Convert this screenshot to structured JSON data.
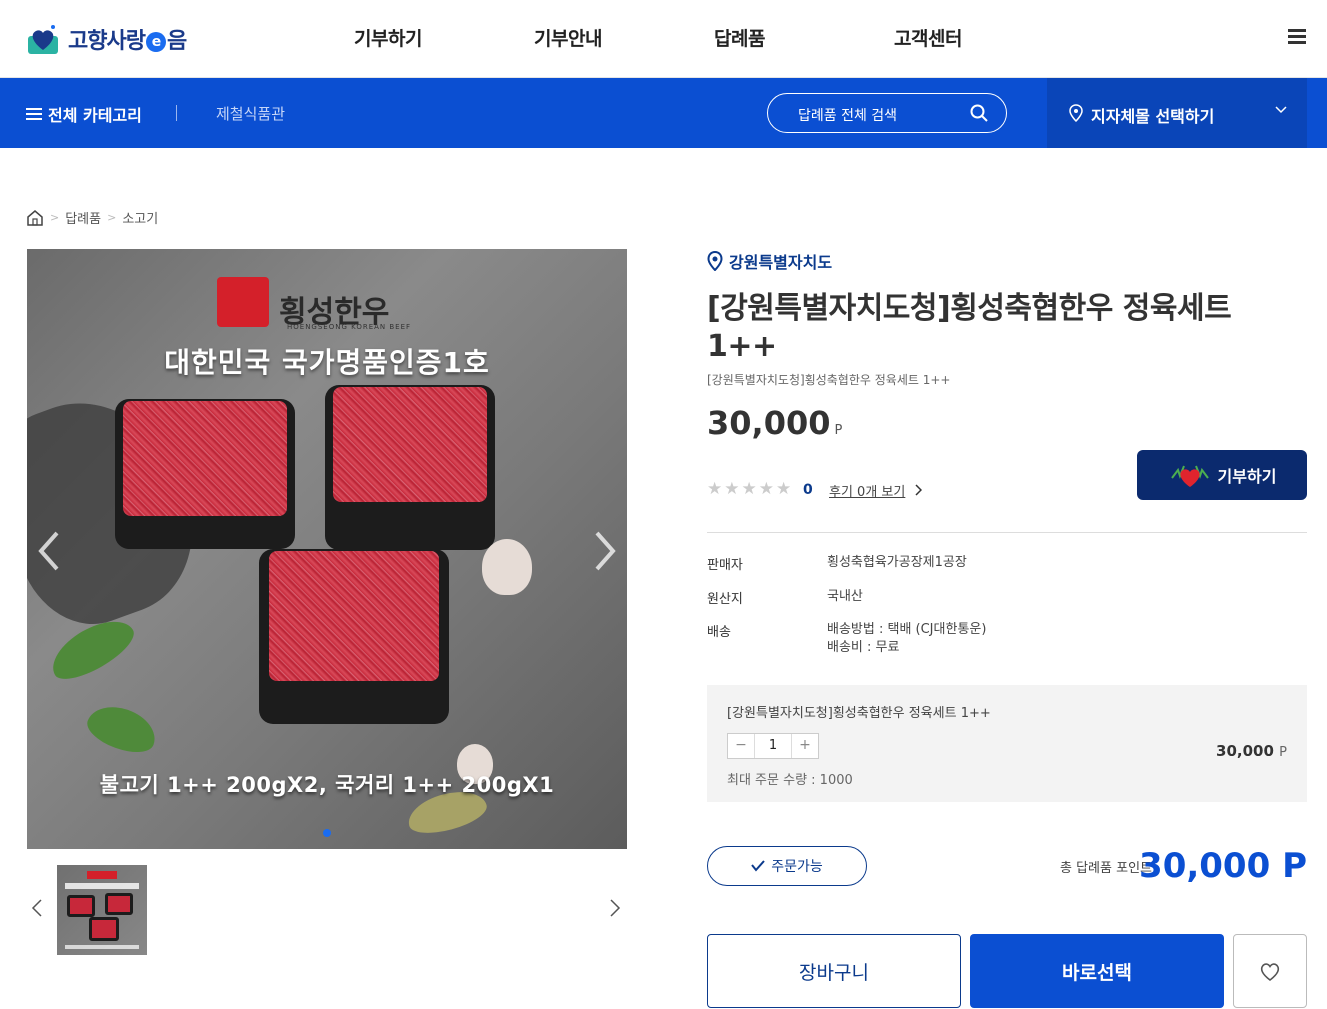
{
  "header": {
    "logo_text_1": "고향사랑",
    "logo_e": "e",
    "logo_text_2": "음",
    "nav": [
      "기부하기",
      "기부안내",
      "답례품",
      "고객센터"
    ]
  },
  "subnav": {
    "category_label": "전체 카테고리",
    "sub_link": "제철식품관",
    "search_placeholder": "답례품 전체 검색",
    "region_select_label": "지자체몰 선택하기"
  },
  "breadcrumb": [
    "답례품",
    "소고기"
  ],
  "gallery": {
    "image_headline": "대한민국 국가명품인증1호",
    "image_brand": "횡성한우",
    "image_brand_sub": "HOENGSEONG KOREAN BEEF",
    "image_bottom_text": "불고기 1++ 200gX2, 국거리 1++ 200gX1"
  },
  "product": {
    "region": "강원특별자치도",
    "title": "[강원특별자치도청]횡성축협한우 정육세트 1++",
    "subtitle": "[강원특별자치도청]횡성축협한우 정육세트 1++",
    "price": "30,000",
    "price_unit": "P",
    "rating_count": "0",
    "review_link": "후기 0개 보기",
    "donate_button": "기부하기"
  },
  "info": [
    {
      "key": "판매자",
      "value": "횡성축협육가공장제1공장"
    },
    {
      "key": "원산지",
      "value": "국내산"
    },
    {
      "key": "배송",
      "value_1": "배송방법 : 택배 (CJ대한통운)",
      "value_2": "배송비 : 무료"
    }
  ],
  "option": {
    "name": "[강원특별자치도청]횡성축협한우 정육세트 1++",
    "qty": "1",
    "minus": "−",
    "plus": "+",
    "price": "30,000",
    "price_unit": "P",
    "max_order": "최대 주문 수량 : 1000"
  },
  "summary": {
    "available": "주문가능",
    "total_label": "총 답례품 포인트",
    "total_value": "30,000 P"
  },
  "actions": {
    "cart": "장바구니",
    "buy": "바로선택"
  },
  "colors": {
    "primary": "#0b4fd2",
    "navy": "#0b2a6e",
    "accent_text": "#0b3a8c"
  }
}
